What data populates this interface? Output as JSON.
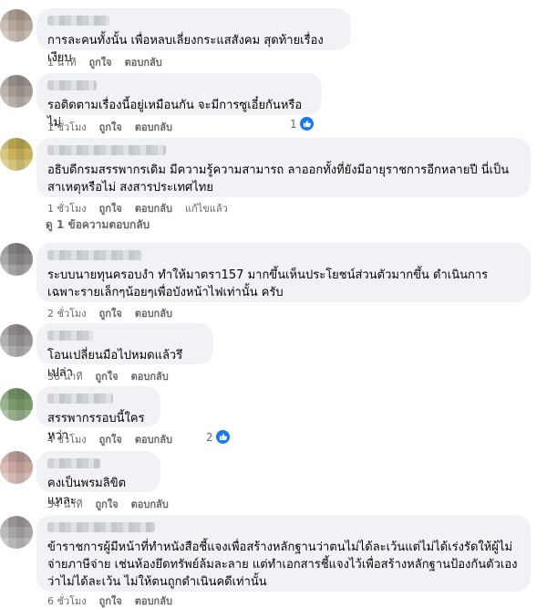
{
  "colors": {
    "bubble": "#f0f2f5",
    "meta": "#65676b",
    "like": "#1877f2"
  },
  "actions": {
    "like": "ถูกใจ",
    "reply": "ตอบกลับ",
    "edited": "แก้ไขแล้ว"
  },
  "comments": [
    {
      "text": "การละคนทั้งนั้น เพื่อหลบเลี่ยงกระแสสังคม สุดท้ายเรื่องเงียบ",
      "time": "1 นาที",
      "reactions": ""
    },
    {
      "text": "รอติดตามเรื่องนี้อยู่เหมือนกัน จะมีการซูเอี๋ยกันหรือไม่",
      "time": "1 ชั่วโมง",
      "reactions": "1"
    },
    {
      "text": "อธิบดีกรมสรรพากรเดิม มีความรู้ความสามารถ ลาออกทั้งที่ยังมีอายุราชการอีกหลายปี นี่เป็นสาเหตุหรือไม่ สงสารประเทศไทย",
      "time": "1 ชั่วโมง",
      "reactions": ""
    },
    {
      "text": "ระบบนายทุนครอบงำ ทำให้มาตรา157 มากขึ้นเห็นประโยชน์ส่วนตัวมากขึ้น ดำเนินการเฉพาะรายเล็กๆน้อยๆเพื่อบังหน้าไฟเท่านั้น ครับ",
      "time": "2 ชั่วโมง",
      "reactions": ""
    },
    {
      "text": "โอนเปลี่ยนมือไปหมดแล้วรึเปล่า",
      "time": "36 นาที",
      "reactions": ""
    },
    {
      "text": "สรรพากรรอบนี้ใครหว่า",
      "time": "4 ชั่วโมง",
      "reactions": "2"
    },
    {
      "text": "คงเป็นพรมลิขิตแหละ",
      "time": "34 นาที",
      "reactions": ""
    },
    {
      "text": "ข้าราชการผู้มีหน้าที่ทำหนังสือชี้แจงเพื่อสร้างหลักฐานว่าตนไม่ได้ละเว้นแต่ไม่ได้เร่งรัดให้ผู้ไม่จ่ายภาษีจ่าย เช่นห้องยึดทรัพย์ล้มละลาย แต่ทำเอกสารชี้แจงไว้เพื่อสร้างหลักฐานป้องกันตัวเองว่าไม่ได้ละเว้น ไม่ให้ตนถูกดำเนินคดีเท่านั้น",
      "time": "6 ชั่วโมง",
      "reactions": ""
    }
  ],
  "replies_link": "ดู 1 ข้อความตอบกลับ"
}
